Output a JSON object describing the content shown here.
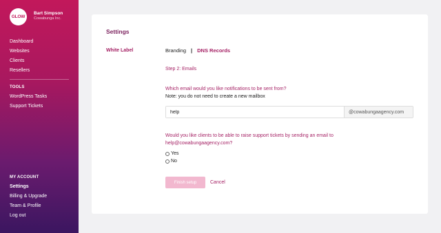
{
  "brand": {
    "logo_text": "GLOW",
    "accent_color": "#c2185b",
    "link_color": "#a41f63"
  },
  "user": {
    "name": "Bart Simpson",
    "company": "Cowabunga Inc."
  },
  "sidebar": {
    "main_items": [
      {
        "label": "Dashboard"
      },
      {
        "label": "Websites"
      },
      {
        "label": "Clients"
      },
      {
        "label": "Resellers"
      }
    ],
    "tools_heading": "TOOLS",
    "tools_items": [
      {
        "label": "WordPress Tasks"
      },
      {
        "label": "Support Tickets"
      }
    ],
    "account_heading": "MY ACCOUNT",
    "account_items": [
      {
        "label": "Settings",
        "active": true
      },
      {
        "label": "Billing & Upgrade"
      },
      {
        "label": "Team & Profile"
      },
      {
        "label": "Log out"
      }
    ]
  },
  "main": {
    "title": "Settings",
    "section_label": "White Label",
    "tabs": {
      "branding": "Branding",
      "separator": "|",
      "dns": "DNS Records"
    },
    "step": "Step 2: Emails",
    "question_sender": "Which email would you like notifications to be sent from?",
    "note": "Note: you do not need to create a new mailbox",
    "email_input_value": "help",
    "email_suffix": "@cowabungaagency.com",
    "question_support": "Would you like clients to be able to raise support tickets by sending an email to help@cowabungaagency.com?",
    "radio_yes": "Yes",
    "radio_no": "No",
    "finish_button": "Finish setup",
    "cancel_link": "Cancel"
  }
}
